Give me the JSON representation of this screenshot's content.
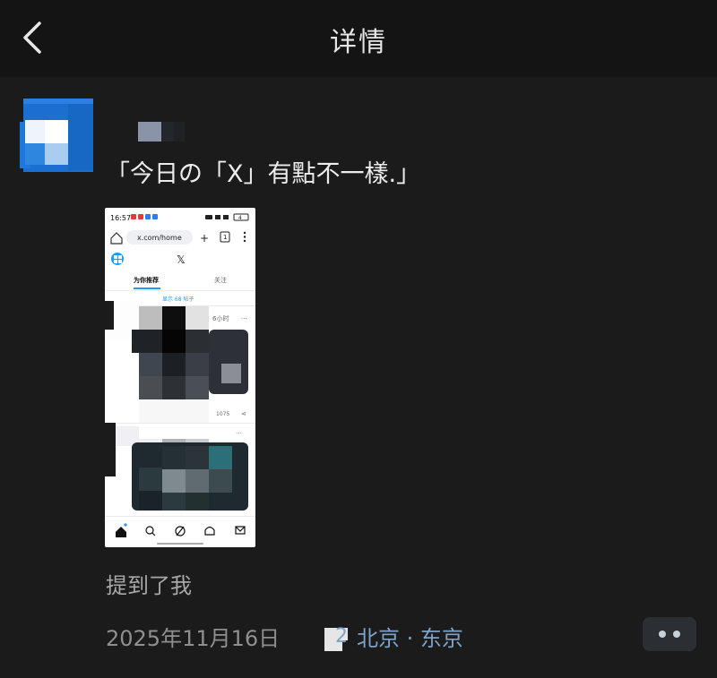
{
  "header": {
    "title": "详情",
    "back_icon": "chevron-left-icon"
  },
  "post": {
    "avatar_color": "#1a73d6",
    "text": "「今日の「X」有點不一樣.」",
    "screenshot": {
      "status_time": "16:57",
      "battery": "4",
      "url": "x.com/home",
      "tab_count": "1",
      "tabs": [
        "为你推荐",
        "关注"
      ],
      "new_posts_banner": "显示 68 帖子",
      "post_time": "6小时",
      "views": "1075",
      "nav_icons": [
        "home-icon",
        "search-icon",
        "grok-icon",
        "bell-icon",
        "mail-icon"
      ]
    },
    "mention": "提到了我",
    "date": "2025年11月16日",
    "location": "北京 · 东京",
    "location_prefix": "2"
  },
  "colors": {
    "background": "#1b1b1b",
    "header_bg": "#141414",
    "link": "#7ea2c9",
    "accent": "#1d9bf0"
  }
}
